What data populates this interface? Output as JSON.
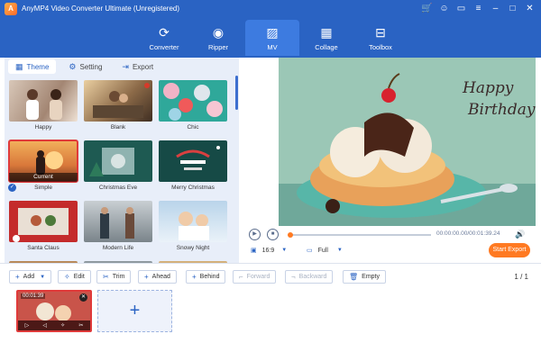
{
  "app": {
    "title": "AnyMP4 Video Converter Ultimate (Unregistered)",
    "logo": "A"
  },
  "window_icons": [
    "cart-icon",
    "user-icon",
    "chat-icon",
    "menu-icon",
    "minimize-icon",
    "maximize-icon",
    "close-icon"
  ],
  "nav": [
    {
      "label": "Converter",
      "icon": "converter-icon",
      "active": false
    },
    {
      "label": "Ripper",
      "icon": "ripper-icon",
      "active": false
    },
    {
      "label": "MV",
      "icon": "mv-icon",
      "active": true
    },
    {
      "label": "Collage",
      "icon": "collage-icon",
      "active": false
    },
    {
      "label": "Toolbox",
      "icon": "toolbox-icon",
      "active": false
    }
  ],
  "tabs": [
    {
      "label": "Theme",
      "active": true
    },
    {
      "label": "Setting",
      "active": false
    },
    {
      "label": "Export",
      "active": false
    }
  ],
  "themes": [
    {
      "name": "Happy"
    },
    {
      "name": "Blank"
    },
    {
      "name": "Chic"
    },
    {
      "name": "Simple",
      "current_label": "Current",
      "selected": true
    },
    {
      "name": "Christmas Eve"
    },
    {
      "name": "Merry Christmas"
    },
    {
      "name": "Santa Claus"
    },
    {
      "name": "Modern Life"
    },
    {
      "name": "Snowy Night"
    }
  ],
  "preview": {
    "overlay_text_1": "Happy",
    "overlay_text_2": "Birthday"
  },
  "player": {
    "time": "00:00:00.00/00:01:39.24",
    "progress": 0.0,
    "aspect_ratio": "16:9",
    "scale": "Full",
    "start_export": "Start Export"
  },
  "toolbar": {
    "add": "Add",
    "edit": "Edit",
    "trim": "Trim",
    "ahead": "Ahead",
    "behind": "Behind",
    "forward": "Forward",
    "backward": "Backward",
    "empty": "Empty",
    "page": "1 / 1"
  },
  "clip": {
    "time": "00:01:39"
  },
  "colors": {
    "titlebar": "#2a63c3",
    "accent": "#ff7a22",
    "selection": "#e03a3a"
  }
}
